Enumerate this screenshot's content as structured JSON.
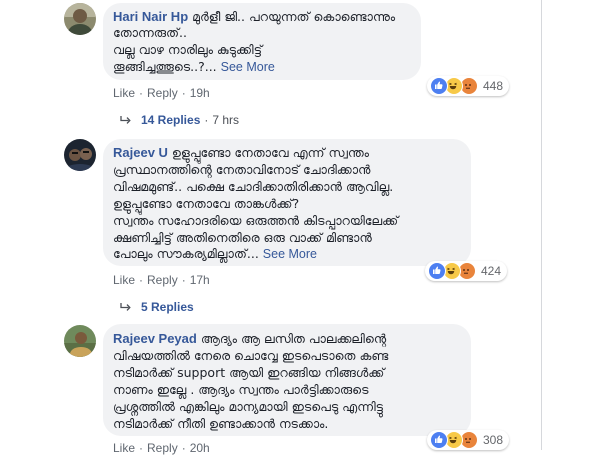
{
  "comments": [
    {
      "author": "Hari Nair Hp",
      "lines": [
        "മുര്‍ളീ ജി.. പറയുന്നത് കൊണ്ടൊന്നും",
        "തോന്നരുത്..",
        "വല്ല വാഴ നാരിലും കുടുക്കിട്ട്",
        "തൂങ്ങിച്ചത്തൂടെ..?..."
      ],
      "see_more": "See More",
      "reaction_count": "448",
      "like": "Like",
      "reply": "Reply",
      "time": "19h",
      "replies_label": "14 Replies",
      "replies_time": "7 hrs"
    },
    {
      "author": "Rajeev U",
      "lines": [
        "ഉളുപ്പുണ്ടോ നേതാവേ എന്ന് സ്വന്തം",
        "പ്രസ്ഥാനത്തിന്റെ നേതാവിനോട് ചോദിക്കാൻ",
        "വിഷമമുണ്ട്.. പക്ഷെ ചോദിക്കാതിരിക്കാൻ ആവില്ല.",
        "ഉളുപ്പുണ്ടോ നേതാവേ താങ്കൾക്ക്?",
        "സ്വന്തം സഹോദരിയെ ഒരുത്തൻ കിടപ്പാറയിലേക്ക്",
        "ക്ഷണിച്ചിട്ട് അതിനെതിരെ ഒരു വാക്ക് മിണ്ടാൻ",
        "പോലും സൗകര്യമില്ലാത്..."
      ],
      "see_more": "See More",
      "reaction_count": "424",
      "like": "Like",
      "reply": "Reply",
      "time": "17h",
      "replies_label": "5 Replies"
    },
    {
      "author": "Rajeev Peyad",
      "lines": [
        "ആദ്യം ആ ലസിത പാലക്കലിന്റെ",
        "വിഷയത്തിൽ നേരെ ചൊവ്വേ ഇടപെടാതെ കണ്ട",
        "നടിമാർക്ക് support ആയി ഇറങ്ങിയ നിങ്ങൾക്ക്",
        "നാണം ഇല്ലേ . ആദ്യം സ്വന്തം പാർട്ടിക്കാരുടെ",
        "പ്രശ്നത്തിൽ എങ്കിലും മാന്യമായി ഇടപെടു എന്നിട്ടു",
        "നടിമാർക്ക് നീതി ഉണ്ടാക്കാൻ നടക്കാം."
      ],
      "reaction_count": "308",
      "like": "Like",
      "reply": "Reply",
      "time": "20h"
    }
  ],
  "colors": {
    "bubble": "#f1f2f4",
    "link": "#365899",
    "like_reaction": "#4d7ff1",
    "haha_reaction": "#f7c948",
    "angry_reaction": "#e9843b"
  }
}
